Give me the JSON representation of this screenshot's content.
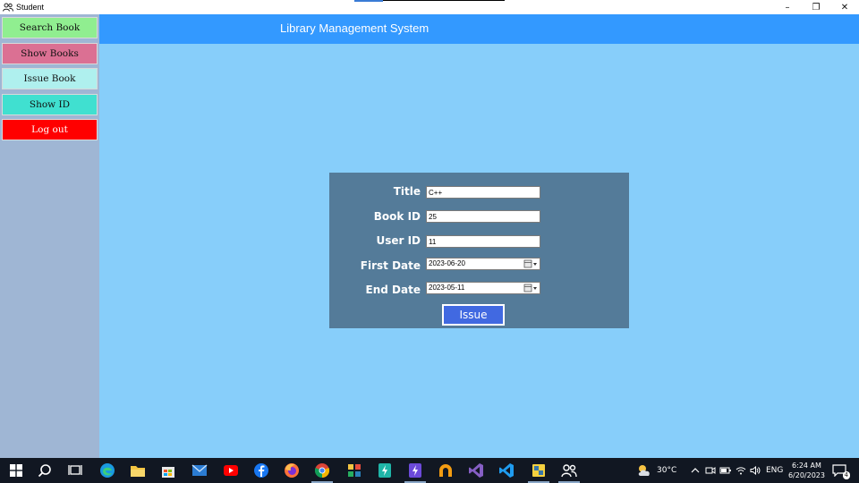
{
  "window": {
    "title": "Student",
    "minimize_glyph": "–",
    "restore_glyph": "❐",
    "close_glyph": "✕"
  },
  "sidebar": {
    "items": [
      {
        "label": "Search Book"
      },
      {
        "label": "Show Books"
      },
      {
        "label": "Issue Book"
      },
      {
        "label": "Show ID"
      },
      {
        "label": "Log out"
      }
    ]
  },
  "header": {
    "title": "Library Management System"
  },
  "form": {
    "title_label": "Title",
    "title_value": "C++",
    "book_id_label": "Book ID",
    "book_id_value": "25",
    "user_id_label": "User ID",
    "user_id_value": "11",
    "first_date_label": "First Date",
    "first_date_value": "2023-06-20",
    "end_date_label": "End Date",
    "end_date_value": "2023-05-11",
    "issue_label": "Issue"
  },
  "taskbar": {
    "weather": "30°C",
    "language": "ENG",
    "time": "6:24 AM",
    "date": "6/20/2023",
    "notification_count": "4"
  },
  "colors": {
    "background": "#87cefa",
    "header": "#3399ff",
    "sidebar": "#9fb6d4",
    "panel": "#547b99",
    "issue_button": "#4169e1",
    "search_button": "#90ee90",
    "show_books_button": "#db7093",
    "issue_book_button": "#aff0ee",
    "show_id_button": "#40e0d0",
    "logout_button": "#ff0000"
  }
}
